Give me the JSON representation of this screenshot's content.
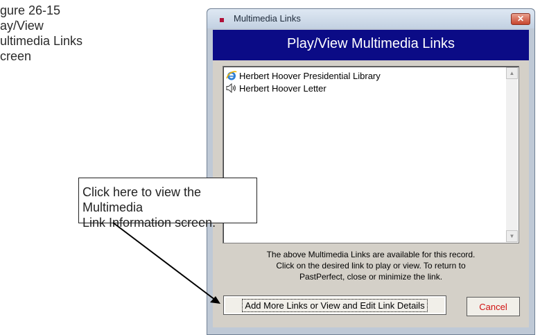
{
  "caption": {
    "text": "gure 26-15\nay/View\nultimedia Links\ncreen"
  },
  "window": {
    "title": "Multimedia Links",
    "close_label": "✕"
  },
  "header": {
    "title": "Play/View Multimedia Links"
  },
  "links": {
    "items": [
      {
        "label": "Herbert Hoover Presidential Library",
        "icon": "internet-explorer-icon"
      },
      {
        "label": "Herbert Hoover Letter",
        "icon": "speaker-icon"
      }
    ]
  },
  "info": {
    "lines": [
      "The above Multimedia Links are available for this record.",
      "Click on the desired link to play or view.  To return to",
      "PastPerfect, close or minimize the link."
    ]
  },
  "buttons": {
    "add_label": "Add More Links or View and Edit Link Details",
    "cancel_label": "Cancel"
  },
  "callout": {
    "text": "Click here to view the Multimedia\nLink Information screen."
  },
  "colors": {
    "header_bg": "#0b0b86",
    "cancel_text": "#d01010",
    "dialog_bg": "#d4d0c8"
  }
}
